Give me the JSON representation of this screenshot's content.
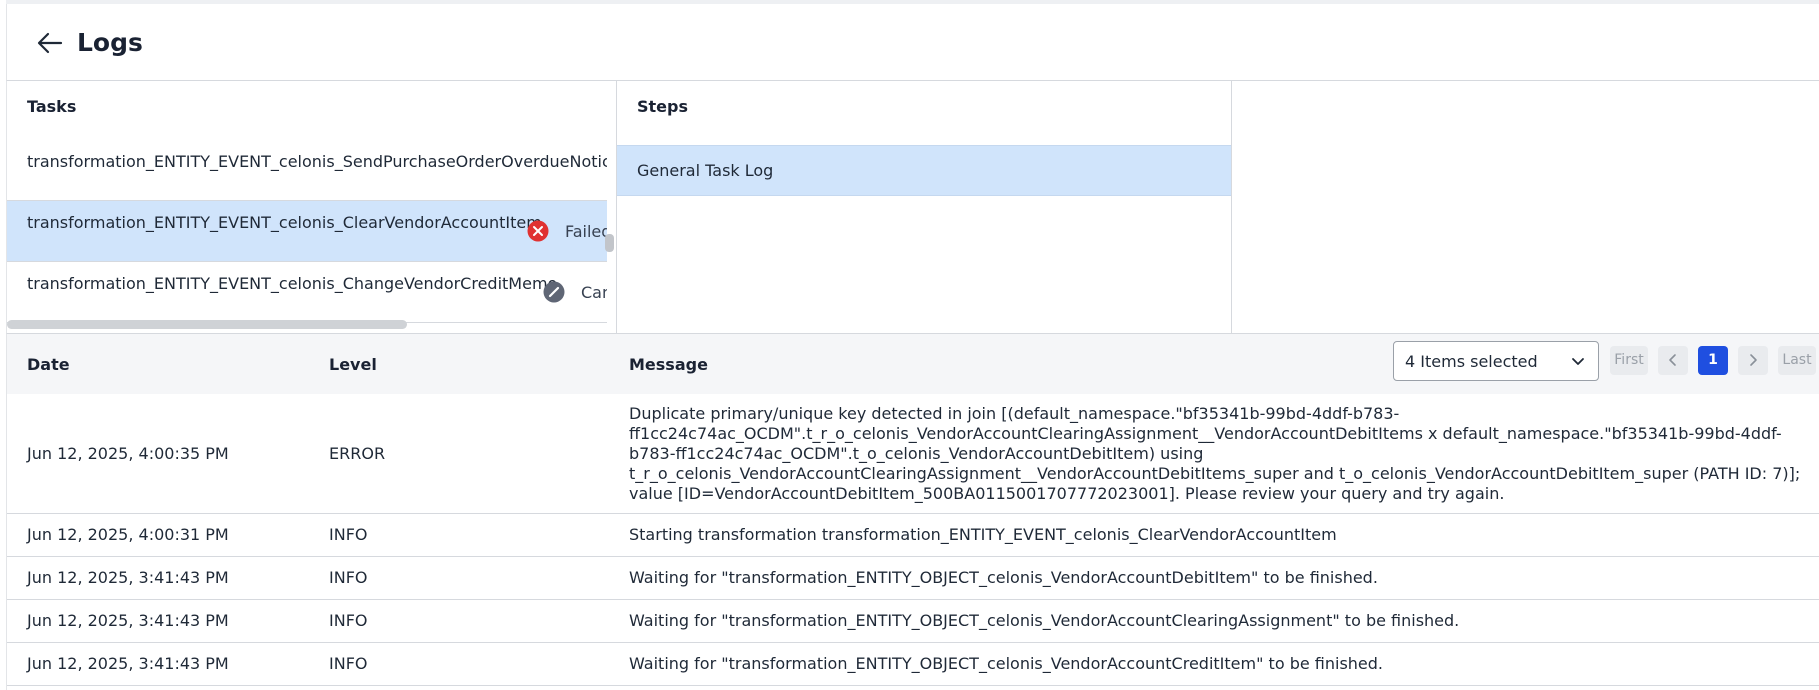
{
  "header": {
    "title": "Logs"
  },
  "tasks": {
    "title": "Tasks",
    "items": [
      {
        "name": "transformation_ENTITY_EVENT_celonis_SendPurchaseOrderOverdueNotice",
        "status": "",
        "status_icon": ""
      },
      {
        "name": "transformation_ENTITY_EVENT_celonis_ClearVendorAccountItem",
        "status": "Failed",
        "status_icon": "error-icon"
      },
      {
        "name": "transformation_ENTITY_EVENT_celonis_ChangeVendorCreditMemo",
        "status": "Canceled",
        "status_icon": "cancel-icon"
      }
    ]
  },
  "steps": {
    "title": "Steps",
    "items": [
      {
        "label": "General Task Log"
      }
    ]
  },
  "logs": {
    "columns": {
      "date": "Date",
      "level": "Level",
      "message": "Message"
    },
    "filter": {
      "label": "4 Items selected"
    },
    "pagination": {
      "first": "First",
      "current": "1",
      "last": "Last"
    },
    "rows": [
      {
        "date": "Jun 12, 2025, 4:00:35 PM",
        "level": "ERROR",
        "message": "Duplicate primary/unique key detected in join [(default_namespace.\"bf35341b-99bd-4ddf-b783-ff1cc24c74ac_OCDM\".t_r_o_celonis_VendorAccountClearingAssignment__VendorAccountDebitItems x default_namespace.\"bf35341b-99bd-4ddf-b783-ff1cc24c74ac_OCDM\".t_o_celonis_VendorAccountDebitItem) using t_r_o_celonis_VendorAccountClearingAssignment__VendorAccountDebitItems_super and t_o_celonis_VendorAccountDebitItem_super (PATH ID: 7)]; value [ID=VendorAccountDebitItem_500BA011500170777202300​1]. Please review your query and try again."
      },
      {
        "date": "Jun 12, 2025, 4:00:31 PM",
        "level": "INFO",
        "message": "Starting transformation transformation_ENTITY_EVENT_celonis_ClearVendorAccountItem"
      },
      {
        "date": "Jun 12, 2025, 3:41:43 PM",
        "level": "INFO",
        "message": "Waiting for \"transformation_ENTITY_OBJECT_celonis_VendorAccountDebitItem\" to be finished."
      },
      {
        "date": "Jun 12, 2025, 3:41:43 PM",
        "level": "INFO",
        "message": "Waiting for \"transformation_ENTITY_OBJECT_celonis_VendorAccountClearingAssignment\" to be finished."
      },
      {
        "date": "Jun 12, 2025, 3:41:43 PM",
        "level": "INFO",
        "message": "Waiting for \"transformation_ENTITY_OBJECT_celonis_VendorAccountCreditItem\" to be finished."
      }
    ]
  },
  "colors": {
    "error": "#e03131",
    "neutral": "#5f6675",
    "selected": "#d0e4fb",
    "accent": "#1f4fe0"
  }
}
